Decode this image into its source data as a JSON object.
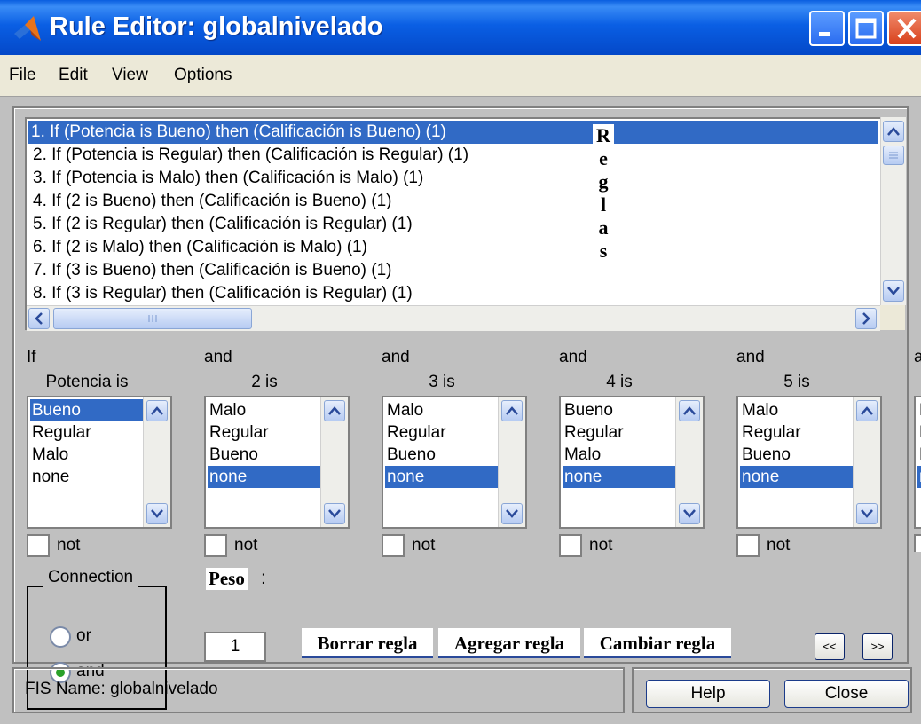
{
  "window": {
    "title": "Rule Editor: globalnivelado"
  },
  "menu": [
    "File",
    "Edit",
    "View",
    "Options"
  ],
  "rules": [
    "1. If (Potencia is Bueno) then (Calificación is Bueno) (1)",
    "2. If (Potencia is Regular) then (Calificación is Regular) (1)",
    "3. If (Potencia is Malo) then (Calificación is Malo) (1)",
    "4. If (2 is Bueno) then (Calificación is Bueno) (1)",
    "5. If (2 is Regular) then (Calificación is Regular) (1)",
    "6. If (2 is Malo) then (Calificación is Malo) (1)",
    "7. If (3 is Bueno) then (Calificación is Bueno) (1)",
    "8. If (3 is Regular) then (Calificación is Regular) (1)"
  ],
  "rules_selected_index": 0,
  "annotation_reglas": [
    "R",
    "e",
    "g",
    "l",
    "a",
    "s"
  ],
  "columns": [
    {
      "connector": "If",
      "variable": "Potencia is",
      "options": [
        "Bueno",
        "Regular",
        "Malo",
        "none"
      ],
      "selected": "Bueno",
      "not_label": "not"
    },
    {
      "connector": "and",
      "variable": "2 is",
      "options": [
        "Malo",
        "Regular",
        "Bueno",
        "none"
      ],
      "selected": "none",
      "not_label": "not"
    },
    {
      "connector": "and",
      "variable": "3 is",
      "options": [
        "Malo",
        "Regular",
        "Bueno",
        "none"
      ],
      "selected": "none",
      "not_label": "not"
    },
    {
      "connector": "and",
      "variable": "4 is",
      "options": [
        "Bueno",
        "Regular",
        "Malo",
        "none"
      ],
      "selected": "none",
      "not_label": "not"
    },
    {
      "connector": "and",
      "variable": "5 is",
      "options": [
        "Malo",
        "Regular",
        "Bueno",
        "none"
      ],
      "selected": "none",
      "not_label": "not"
    }
  ],
  "partial_column": {
    "connector": "a",
    "options": [
      "M",
      "F",
      "E",
      "n"
    ],
    "selected_index": 3
  },
  "connection": {
    "title": "Connection",
    "options": [
      "or",
      "and"
    ],
    "selected": "and"
  },
  "weight": {
    "label": "Peso",
    "colon": ":",
    "value": "1"
  },
  "actions": {
    "delete": "Borrar regla",
    "add": "Agregar regla",
    "change": "Cambiar regla"
  },
  "nav": {
    "prev": "<<",
    "next": ">>"
  },
  "status": {
    "fis_name": "FIS Name: globalnivelado"
  },
  "buttons": {
    "help": "Help",
    "close": "Close"
  },
  "colors": {
    "titlebar": "#0a5fe4",
    "selection": "#316ac5",
    "panel": "#c0c0c0",
    "close_button": "#d8401c"
  }
}
